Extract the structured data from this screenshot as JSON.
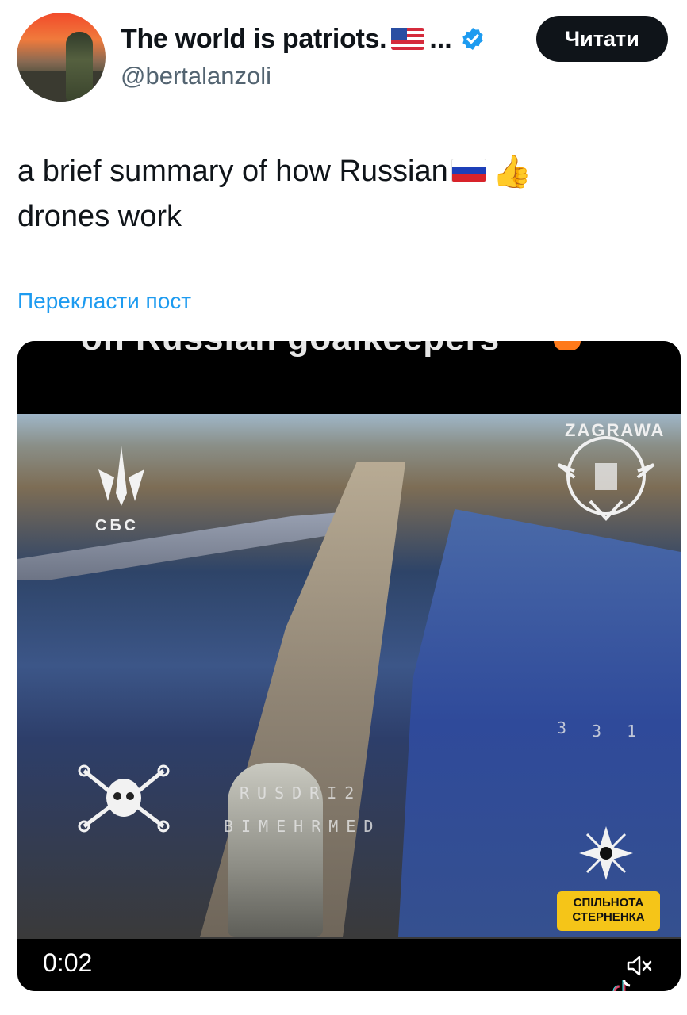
{
  "author": {
    "name": "The world is patriots.",
    "flag_icon": "us-flag-icon",
    "ellipsis": "...",
    "handle": "@bertalanzoli",
    "verified_icon": "verified-badge-icon",
    "avatar": "avatar"
  },
  "follow_button": {
    "label": "Читати"
  },
  "tweet": {
    "text_line1": "a brief summary of how Russian",
    "text_line2": "drones work",
    "flag_icon": "russia-flag-icon",
    "emoji_icon": "thumbs-up-icon",
    "emoji": "👍"
  },
  "translate_link": "Перекласти пост",
  "video": {
    "top_caption": "on Russian goalkeepers",
    "time": "0:02",
    "overlay_labels": {
      "sbs": "СБС",
      "zagrawa": "ZAGRAWA",
      "hud_line1": "RUSDRI2",
      "hud_line2": "BIMEHRMED",
      "hud_digit1": "3",
      "hud_digit2": "3 1",
      "sternenko_line1": "СПІЛЬНОТА",
      "sternenko_line2": "СТЕРНЕНКА"
    },
    "mute_icon": "speaker-muted-icon",
    "tiktok_icon": "tiktok-icon"
  },
  "colors": {
    "link": "#1d9bf0",
    "verified": "#1d9bf0",
    "button_bg": "#0f1419",
    "secondary_text": "#536471"
  }
}
